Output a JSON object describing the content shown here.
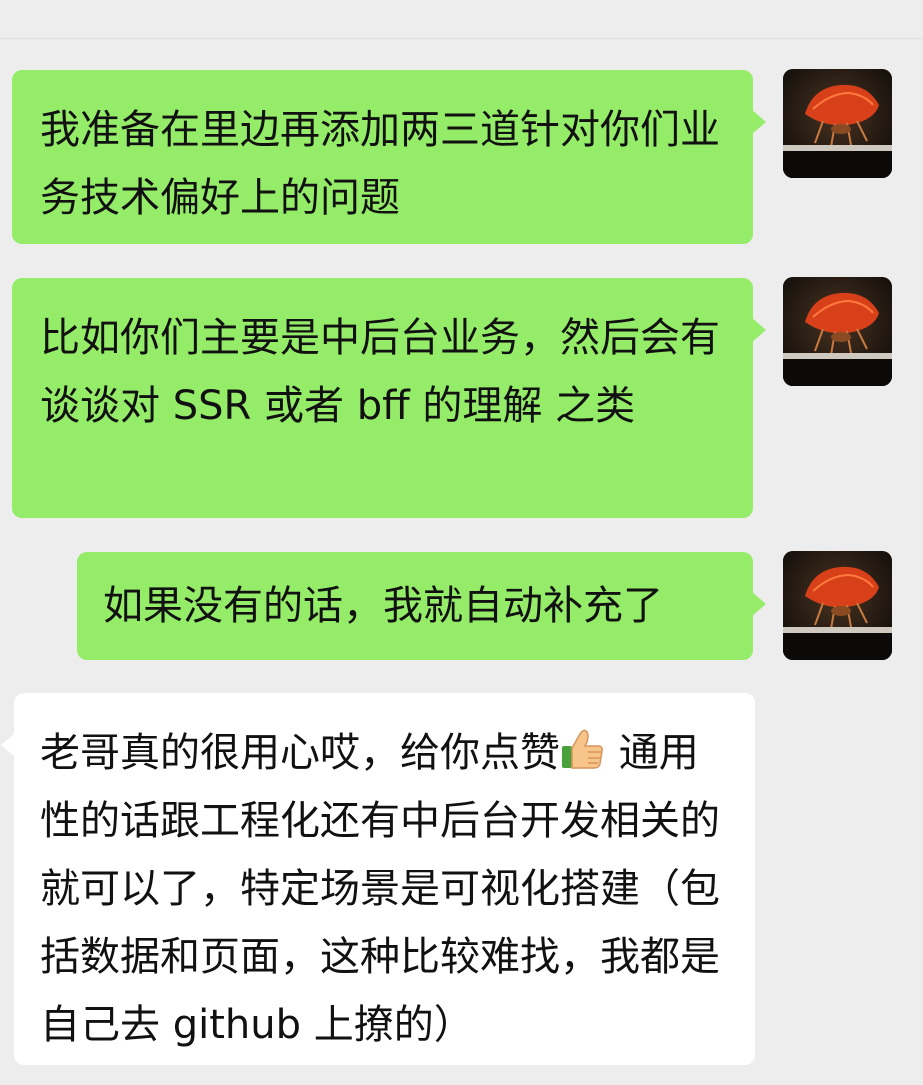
{
  "messages": [
    {
      "sender": "self",
      "text": "我准备在里边再添加两三道针对你们业务技术偏好上的问题"
    },
    {
      "sender": "self",
      "text": "比如你们主要是中后台业务，然后会有谈谈对 SSR 或者 bff 的理解 之类"
    },
    {
      "sender": "self",
      "text": "如果没有的话，我就自动补充了"
    },
    {
      "sender": "other",
      "text_before_emoji": "老哥真的很用心哎，给你点赞",
      "emoji": "thumbs-up-emoji",
      "text_after_emoji": " 通用性的话跟工程化还有中后台开发相关的就可以了，特定场景是可视化搭建（包括数据和页面，这种比较难找，我都是自己去 github 上撩的）"
    }
  ],
  "colors": {
    "background": "#ededed",
    "outgoing_bubble": "#95ec69",
    "incoming_bubble": "#ffffff",
    "text": "#111111"
  },
  "icons": {
    "avatar": "leaf-insect-avatar"
  }
}
